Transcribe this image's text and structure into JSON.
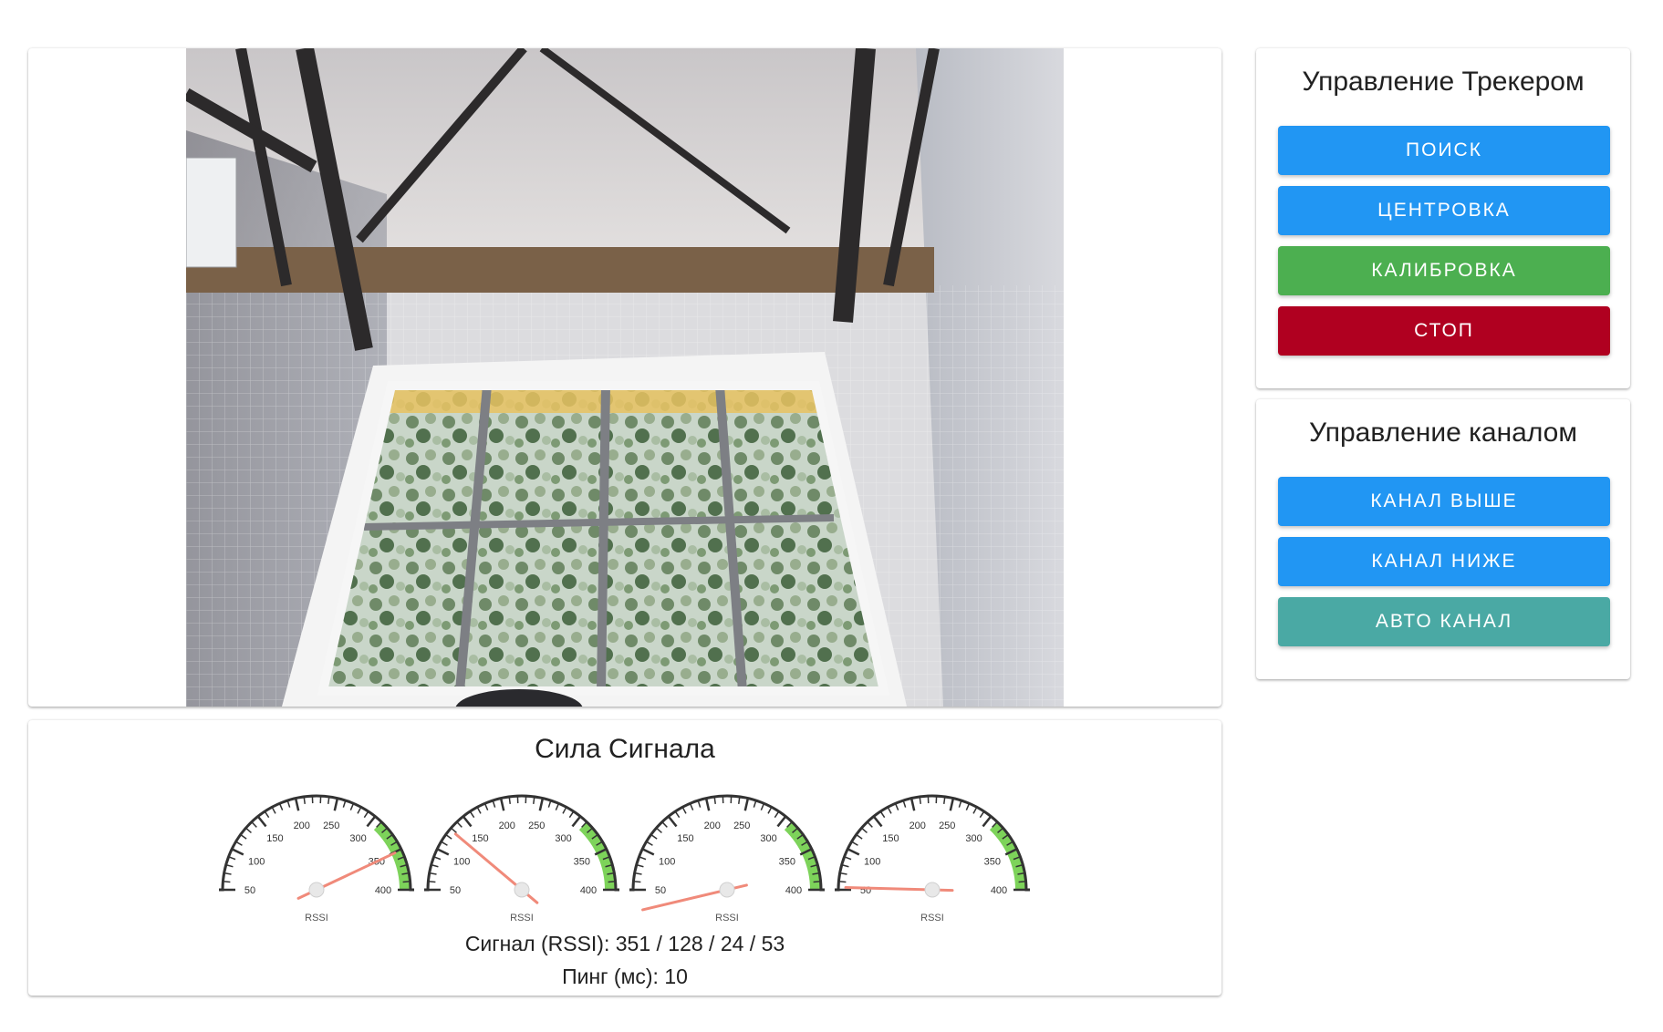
{
  "tracker_panel": {
    "title": "Управление Трекером",
    "buttons": [
      "ПОИСК",
      "ЦЕНТРОВКА",
      "КАЛИБРОВКА",
      "СТОП"
    ]
  },
  "channel_panel": {
    "title": "Управление каналом",
    "buttons": [
      "КАНАЛ ВЫШЕ",
      "КАНАЛ НИЖЕ",
      "АВТО КАНАЛ"
    ]
  },
  "signal_panel": {
    "title": "Сила Сигнала",
    "rssi_text": "Сигнал (RSSI): 351 / 128 / 24 / 53",
    "ping_text": "Пинг (мс): 10",
    "gauge_label": "RSSI",
    "gauge_ticks": [
      "50",
      "100",
      "150",
      "200",
      "250",
      "300",
      "350",
      "400"
    ]
  },
  "chart_data": {
    "type": "gauge",
    "unit_label": "RSSI",
    "min": 50,
    "max": 400,
    "green_zone": [
      310,
      400
    ],
    "values": [
      351,
      128,
      24,
      53
    ]
  },
  "colors": {
    "primary": "#2196f3",
    "success": "#4caf50",
    "danger": "#b00020",
    "teal": "#4aa9a4",
    "gauge_green": "#7dd35a",
    "needle": "#f08a7a"
  }
}
